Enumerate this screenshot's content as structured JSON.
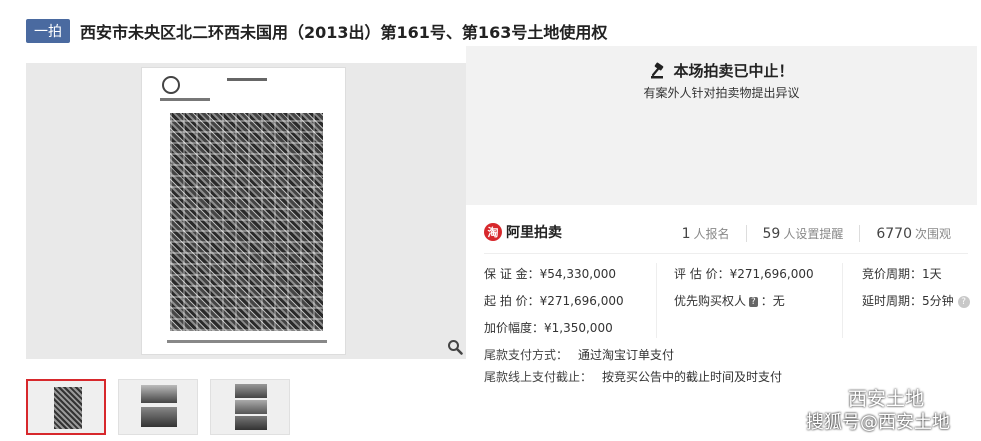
{
  "header": {
    "tag": "一拍",
    "title": "西安市未央区北二环西未国用（2013出）第161号、第163号土地使用权"
  },
  "status": {
    "title": "本场拍卖已中止！",
    "subtitle": "有案外人针对拍卖物提出异议"
  },
  "brand": {
    "logo_glyph": "淘",
    "name": "阿里拍卖"
  },
  "stats": [
    {
      "value": "1",
      "label": "人报名"
    },
    {
      "value": "59",
      "label": "人设置提醒"
    },
    {
      "value": "6770",
      "label": "次围观"
    }
  ],
  "details": {
    "deposit": "保 证 金：¥54,330,000",
    "appraisal": "评 估 价：¥271,696,000",
    "bid_period": "竞价周期：1天",
    "start_price": "起 拍 价：¥271,696,000",
    "priority_label": "优先购买权人",
    "priority_badge": "?",
    "priority_value": "：无",
    "extension": "延时周期：5分钟",
    "increment": "加价幅度：¥1,350,000"
  },
  "payment": {
    "method_label": "尾款支付方式：",
    "method_value": "通过淘宝订单支付",
    "deadline_label": "尾款线上支付截止：",
    "deadline_value": "按竞买公告中的截止时间及时支付"
  },
  "watermark": {
    "line1": "西安土地",
    "line2": "搜狐号@西安土地"
  },
  "icons": {
    "gavel": "gavel-icon",
    "zoom": "magnifier-icon",
    "help": "question-icon",
    "wechat": "wechat-icon"
  },
  "colors": {
    "tag_bg": "#4a6aa0",
    "accent_red": "#d7282c",
    "status_bg": "#f2f2f2"
  }
}
